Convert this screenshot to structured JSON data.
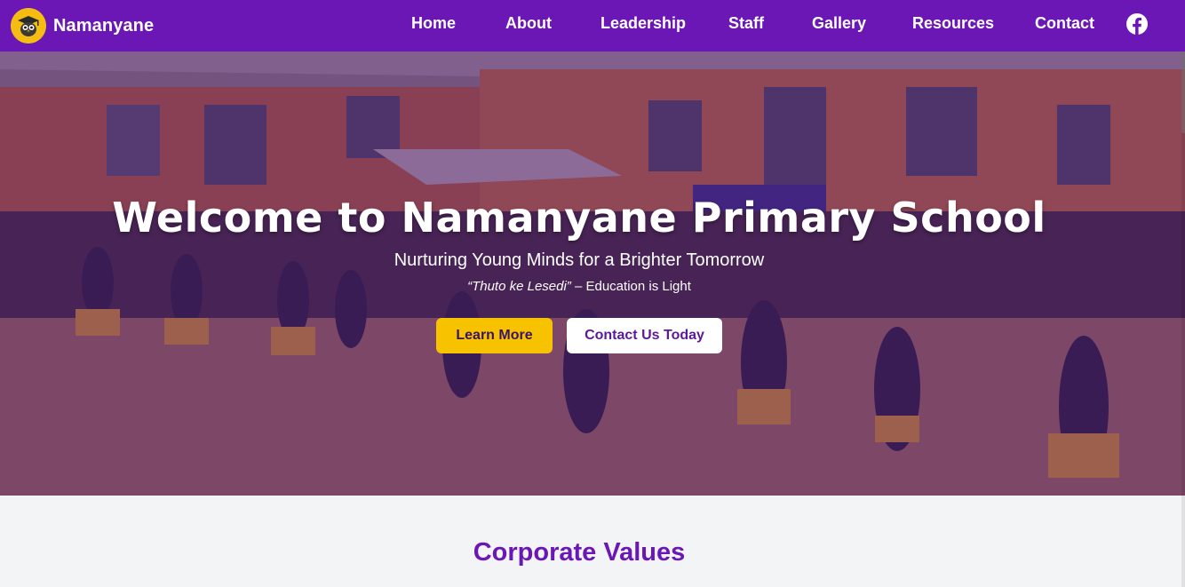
{
  "brand": {
    "name": "Namanyane",
    "logo_icon": "owl-graduate-logo"
  },
  "nav": {
    "links": [
      "Home",
      "About",
      "Leadership",
      "Staff",
      "Gallery",
      "Resources",
      "Contact"
    ],
    "social_icon": "facebook-icon"
  },
  "hero": {
    "title": "Welcome to Namanyane Primary School",
    "subtitle": "Nurturing Young Minds for a Brighter Tomorrow",
    "motto_quote": "“Thuto ke Lesedi”",
    "motto_translation": " – Education is Light",
    "buttons": {
      "learn_more": "Learn More",
      "contact": "Contact Us Today"
    },
    "background_image": "school-dancers-photo"
  },
  "values": {
    "title": "Corporate Values"
  },
  "colors": {
    "primary": "#6b17b5",
    "accent": "#f7c200",
    "background": "#f3f4f6",
    "white": "#ffffff"
  }
}
